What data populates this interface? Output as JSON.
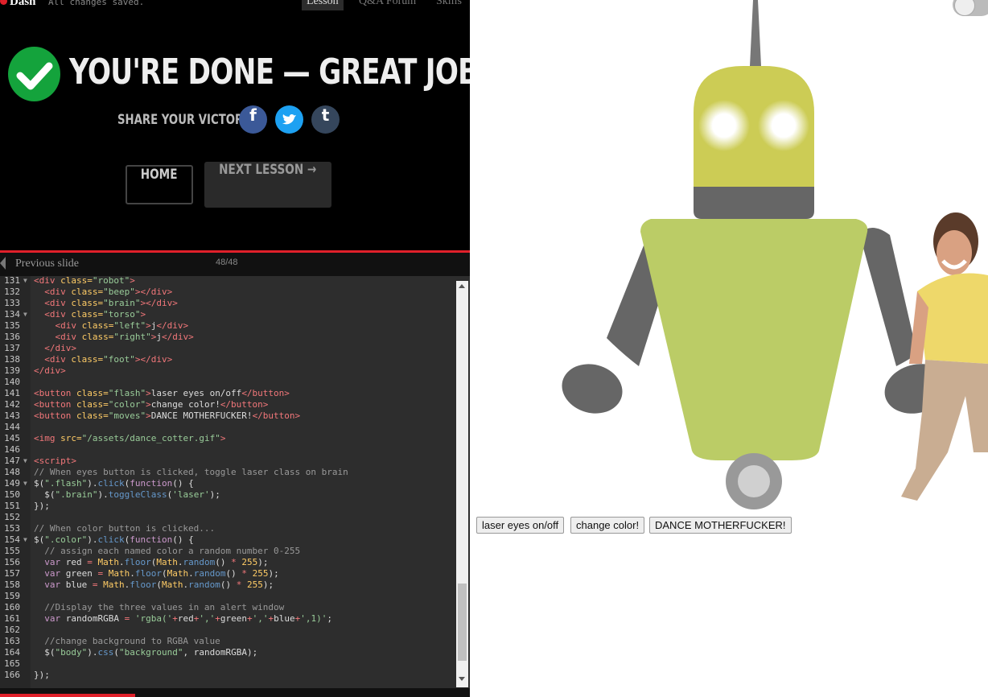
{
  "app": {
    "logo": "Dash",
    "save_status": "All changes saved."
  },
  "tabs": [
    {
      "label": "Lesson",
      "active": true
    },
    {
      "label": "Q&A Forum"
    },
    {
      "label": "Skills"
    }
  ],
  "completion": {
    "title": "YOU'RE DONE — GREAT JOB!",
    "share_label": "SHARE YOUR VICTORY:",
    "social": [
      "facebook-icon",
      "twitter-icon",
      "tumblr-icon"
    ],
    "home_label": "HOME",
    "next_label": "NEXT LESSON →"
  },
  "slide_nav": {
    "prev_label": "Previous slide",
    "counter": "48/48"
  },
  "editor": {
    "first_line": 131,
    "fold_lines": [
      131,
      134,
      147,
      149,
      154
    ],
    "lines": [
      [
        [
          "t",
          "<div "
        ],
        [
          "a",
          "class="
        ],
        [
          "s",
          "\"robot\""
        ],
        [
          "t",
          ">"
        ]
      ],
      [
        [
          "",
          "  "
        ],
        [
          "t",
          "<div "
        ],
        [
          "a",
          "class="
        ],
        [
          "s",
          "\"beep\""
        ],
        [
          "t",
          "></div>"
        ]
      ],
      [
        [
          "",
          "  "
        ],
        [
          "t",
          "<div "
        ],
        [
          "a",
          "class="
        ],
        [
          "s",
          "\"brain\""
        ],
        [
          "t",
          "></div>"
        ]
      ],
      [
        [
          "",
          "  "
        ],
        [
          "t",
          "<div "
        ],
        [
          "a",
          "class="
        ],
        [
          "s",
          "\"torso\""
        ],
        [
          "t",
          ">"
        ]
      ],
      [
        [
          "",
          "    "
        ],
        [
          "t",
          "<div "
        ],
        [
          "a",
          "class="
        ],
        [
          "s",
          "\"left\""
        ],
        [
          "t",
          ">"
        ],
        [
          "",
          "j"
        ],
        [
          "t",
          "</div>"
        ]
      ],
      [
        [
          "",
          "    "
        ],
        [
          "t",
          "<div "
        ],
        [
          "a",
          "class="
        ],
        [
          "s",
          "\"right\""
        ],
        [
          "t",
          ">"
        ],
        [
          "",
          "j"
        ],
        [
          "t",
          "</div>"
        ]
      ],
      [
        [
          "",
          "  "
        ],
        [
          "t",
          "</div>"
        ]
      ],
      [
        [
          "",
          "  "
        ],
        [
          "t",
          "<div "
        ],
        [
          "a",
          "class="
        ],
        [
          "s",
          "\"foot\""
        ],
        [
          "t",
          "></div>"
        ]
      ],
      [
        [
          "t",
          "</div>"
        ]
      ],
      [],
      [
        [
          "t",
          "<button "
        ],
        [
          "a",
          "class="
        ],
        [
          "s",
          "\"flash\""
        ],
        [
          "t",
          ">"
        ],
        [
          "",
          "laser eyes on/off"
        ],
        [
          "t",
          "</button>"
        ]
      ],
      [
        [
          "t",
          "<button "
        ],
        [
          "a",
          "class="
        ],
        [
          "s",
          "\"color\""
        ],
        [
          "t",
          ">"
        ],
        [
          "",
          "change color!"
        ],
        [
          "t",
          "</button>"
        ]
      ],
      [
        [
          "t",
          "<button "
        ],
        [
          "a",
          "class="
        ],
        [
          "s",
          "\"moves\""
        ],
        [
          "t",
          ">"
        ],
        [
          "",
          "DANCE MOTHERFUCKER!"
        ],
        [
          "t",
          "</button>"
        ]
      ],
      [],
      [
        [
          "t",
          "<img "
        ],
        [
          "a",
          "src="
        ],
        [
          "s",
          "\"/assets/dance_cotter.gif\""
        ],
        [
          "t",
          ">"
        ]
      ],
      [],
      [
        [
          "t",
          "<script>"
        ]
      ],
      [
        [
          "c",
          "// When eyes button is clicked, toggle laser class on brain"
        ]
      ],
      [
        [
          "",
          "$("
        ],
        [
          "s",
          "\".flash\""
        ],
        [
          "",
          ")."
        ],
        [
          "f",
          "click"
        ],
        [
          "",
          "("
        ],
        [
          "k",
          "function"
        ],
        [
          "",
          "() {"
        ]
      ],
      [
        [
          "",
          "  $("
        ],
        [
          "s",
          "\".brain\""
        ],
        [
          "",
          ")."
        ],
        [
          "f",
          "toggleClass"
        ],
        [
          "",
          "("
        ],
        [
          "s",
          "'laser'"
        ],
        [
          "",
          ");"
        ]
      ],
      [
        [
          "",
          "});"
        ]
      ],
      [],
      [
        [
          "c",
          "// When color button is clicked..."
        ]
      ],
      [
        [
          "",
          "$("
        ],
        [
          "s",
          "\".color\""
        ],
        [
          "",
          ")."
        ],
        [
          "f",
          "click"
        ],
        [
          "",
          "("
        ],
        [
          "k",
          "function"
        ],
        [
          "",
          "() {"
        ]
      ],
      [
        [
          "c",
          "  // assign each named color a random number 0-255"
        ]
      ],
      [
        [
          "",
          "  "
        ],
        [
          "k",
          "var"
        ],
        [
          "",
          " red "
        ],
        [
          "t",
          "="
        ],
        [
          "",
          " "
        ],
        [
          "a",
          "Math"
        ],
        [
          "",
          "."
        ],
        [
          "f",
          "floor"
        ],
        [
          "",
          "("
        ],
        [
          "a",
          "Math"
        ],
        [
          "",
          "."
        ],
        [
          "f",
          "random"
        ],
        [
          "",
          "() "
        ],
        [
          "t",
          "*"
        ],
        [
          "",
          " "
        ],
        [
          "a",
          "255"
        ],
        [
          "",
          ");"
        ]
      ],
      [
        [
          "",
          "  "
        ],
        [
          "k",
          "var"
        ],
        [
          "",
          " green "
        ],
        [
          "t",
          "="
        ],
        [
          "",
          " "
        ],
        [
          "a",
          "Math"
        ],
        [
          "",
          "."
        ],
        [
          "f",
          "floor"
        ],
        [
          "",
          "("
        ],
        [
          "a",
          "Math"
        ],
        [
          "",
          "."
        ],
        [
          "f",
          "random"
        ],
        [
          "",
          "() "
        ],
        [
          "t",
          "*"
        ],
        [
          "",
          " "
        ],
        [
          "a",
          "255"
        ],
        [
          "",
          ");"
        ]
      ],
      [
        [
          "",
          "  "
        ],
        [
          "k",
          "var"
        ],
        [
          "",
          " blue "
        ],
        [
          "t",
          "="
        ],
        [
          "",
          " "
        ],
        [
          "a",
          "Math"
        ],
        [
          "",
          "."
        ],
        [
          "f",
          "floor"
        ],
        [
          "",
          "("
        ],
        [
          "a",
          "Math"
        ],
        [
          "",
          "."
        ],
        [
          "f",
          "random"
        ],
        [
          "",
          "() "
        ],
        [
          "t",
          "*"
        ],
        [
          "",
          " "
        ],
        [
          "a",
          "255"
        ],
        [
          "",
          ");"
        ]
      ],
      [],
      [
        [
          "c",
          "  //Display the three values in an alert window"
        ]
      ],
      [
        [
          "",
          "  "
        ],
        [
          "k",
          "var"
        ],
        [
          "",
          " randomRGBA "
        ],
        [
          "t",
          "="
        ],
        [
          "",
          " "
        ],
        [
          "s",
          "'rgba('"
        ],
        [
          "t",
          "+"
        ],
        [
          "",
          "red"
        ],
        [
          "t",
          "+"
        ],
        [
          "s",
          "','"
        ],
        [
          "t",
          "+"
        ],
        [
          "",
          "green"
        ],
        [
          "t",
          "+"
        ],
        [
          "s",
          "','"
        ],
        [
          "t",
          "+"
        ],
        [
          "",
          "blue"
        ],
        [
          "t",
          "+"
        ],
        [
          "s",
          "',1)'"
        ],
        [
          "",
          ";"
        ]
      ],
      [],
      [
        [
          "c",
          "  //change background to RGBA value"
        ]
      ],
      [
        [
          "",
          "  $("
        ],
        [
          "s",
          "\"body\""
        ],
        [
          "",
          ")."
        ],
        [
          "f",
          "css"
        ],
        [
          "",
          "("
        ],
        [
          "s",
          "\"background\""
        ],
        [
          "",
          ", randomRGBA);"
        ]
      ],
      [],
      [
        [
          "",
          "});"
        ]
      ]
    ]
  },
  "preview": {
    "buttons": {
      "flash": "laser eyes on/off",
      "color": "change color!",
      "moves": "DANCE MOTHERFUCKER!"
    },
    "colors": {
      "head": "#cccc55",
      "torso": "#bbcc66",
      "limbs": "#666666",
      "foot": "#999999"
    }
  }
}
